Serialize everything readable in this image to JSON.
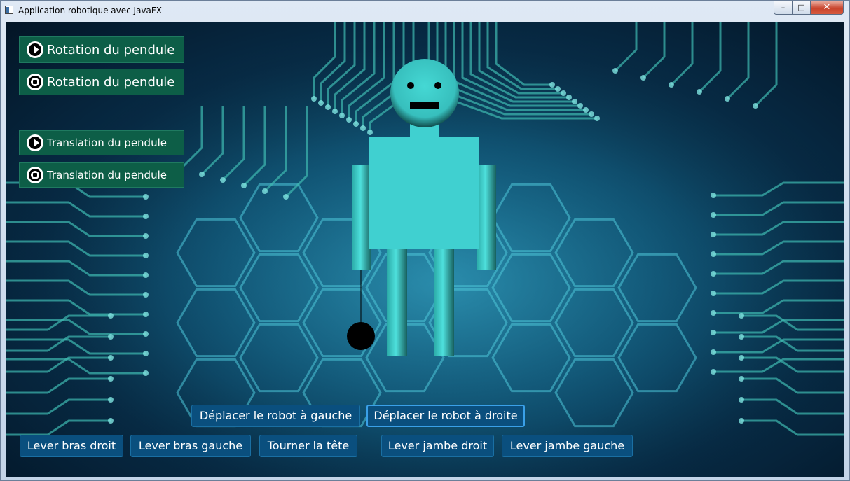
{
  "window": {
    "title": "Application robotique avec JavaFX"
  },
  "controls": {
    "rotation_start": "Rotation du pendule",
    "rotation_stop": "Rotation du pendule",
    "translation_start": "Translation du pendule",
    "translation_stop": "Translation du pendule"
  },
  "actions": {
    "move_left": "Déplacer le robot à gauche",
    "move_right": "Déplacer le robot à droite",
    "raise_right_arm": "Lever bras droit",
    "raise_left_arm": "Lever bras gauche",
    "turn_head": "Tourner la tête",
    "raise_right_leg": "Lever jambe droit",
    "raise_left_leg": "Lever jambe gauche"
  },
  "icons": {
    "play": "play-circle-icon",
    "stop": "stop-circle-icon"
  },
  "colors": {
    "robot": "#40d0d0",
    "control_button": "#0d5e47",
    "action_button": "#0a4f7e",
    "pendulum": "#000000"
  }
}
